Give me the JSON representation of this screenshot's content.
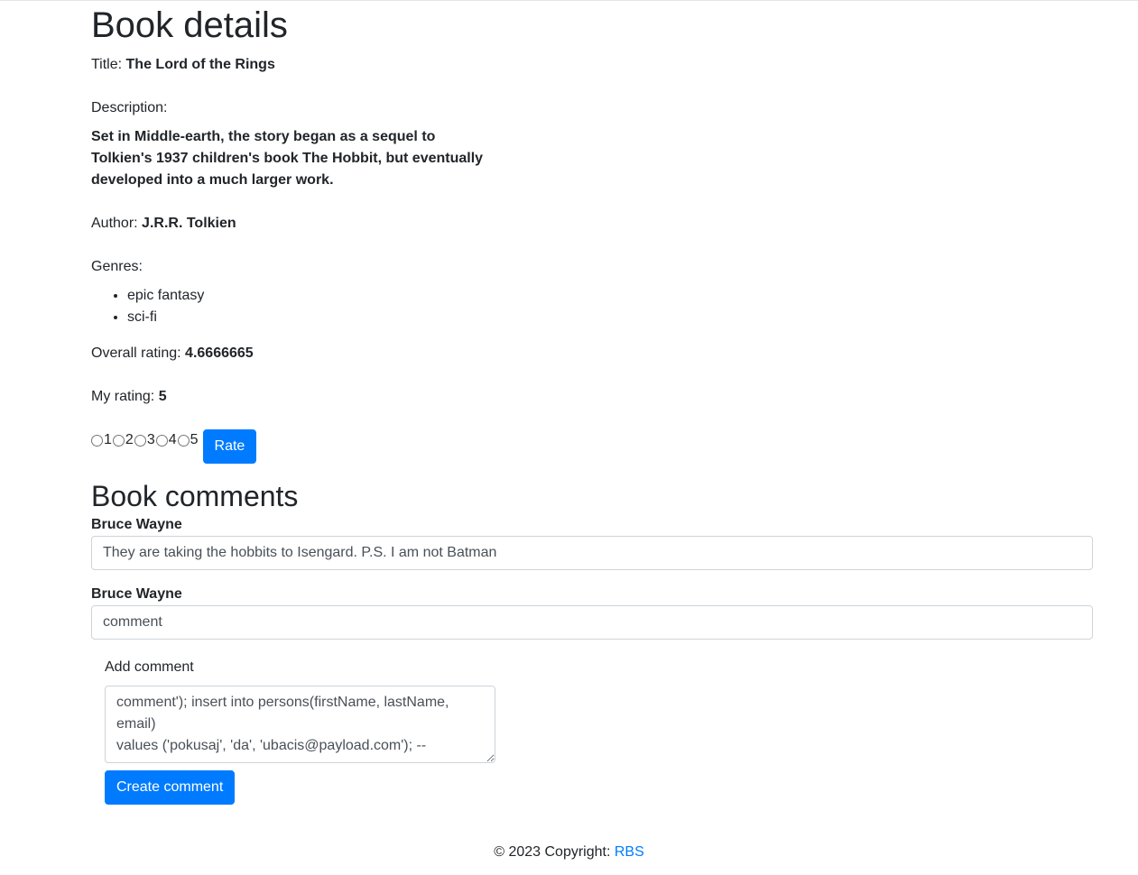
{
  "page": {
    "heading": "Book details",
    "title_label": "Title:",
    "title_value": "The Lord of the Rings",
    "description_label": "Description:",
    "description_value": "Set in Middle-earth, the story began as a sequel to Tolkien's 1937 children's book The Hobbit, but eventually developed into a much larger work.",
    "author_label": "Author:",
    "author_value": "J.R.R. Tolkien",
    "genres_label": "Genres:",
    "genres": [
      "epic fantasy",
      "sci-fi"
    ],
    "overall_rating_label": "Overall rating:",
    "overall_rating_value": "4.6666665",
    "my_rating_label": "My rating:",
    "my_rating_value": "5"
  },
  "rate_form": {
    "options": [
      "1",
      "2",
      "3",
      "4",
      "5"
    ],
    "button_label": "Rate"
  },
  "comments": {
    "heading": "Book comments",
    "items": [
      {
        "author": "Bruce Wayne",
        "text": "They are taking the hobbits to Isengard. P.S. I am not Batman"
      },
      {
        "author": "Bruce Wayne",
        "text": "comment"
      }
    ],
    "add_label": "Add comment",
    "textarea_value": "comment'); insert into persons(firstName, lastName, email)\nvalues ('pokusaj', 'da', 'ubacis@payload.com'); --",
    "create_button_label": "Create comment"
  },
  "footer": {
    "copyright_text": "© 2023 Copyright:",
    "link_text": "RBS"
  },
  "colors": {
    "primary": "#007bff",
    "text": "#212529",
    "input_border": "#ced4da"
  }
}
